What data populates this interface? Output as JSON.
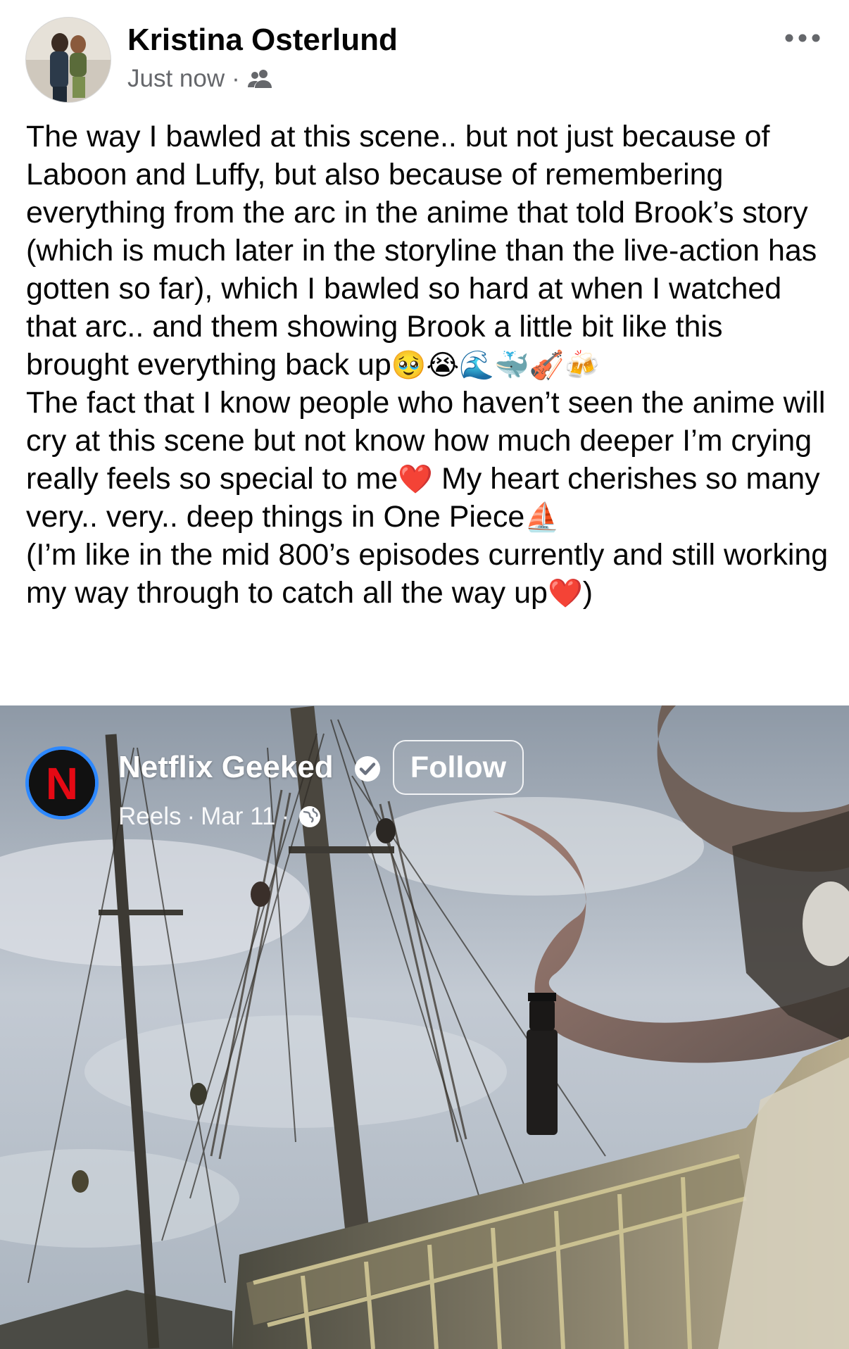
{
  "post": {
    "author": {
      "name": "Kristina Osterlund",
      "avatar_icon": "profile-photo"
    },
    "timestamp": "Just now",
    "separator": "·",
    "audience_icon": "friends-icon",
    "more_icon": "more-options-icon",
    "text": {
      "p1": "The way I bawled at this scene.. but not just because of Laboon and Luffy, but also because of remembering everything from the arc in the anime that told Brook’s story (which is much later in the storyline than the live-action has gotten so far), which I bawled so hard at when I watched that arc.. and them showing Brook a little bit like this brought everything back up",
      "p1_emoji": "🥹😭🌊🐳🎻🍻",
      "p2a": "The fact that I know people who haven’t seen the anime will cry at this scene but not know how much deeper I’m crying really feels so special to me",
      "p2_heart": "❤️",
      "p2b": " My heart cherishes so many very.. very.. deep things in One Piece",
      "p2_boat": "⛵",
      "p3a": "(I’m like in the mid 800’s episodes currently and still working my way through to catch all the way up",
      "p3_heart": "❤️",
      "p3b": ")"
    }
  },
  "shared_reel": {
    "page_name": "Netflix Geeked",
    "verified_icon": "verified-badge-icon",
    "follow_label": "Follow",
    "type": "Reels",
    "date": "Mar 11",
    "separator": "·",
    "privacy_icon": "globe-icon",
    "logo_letter": "N"
  },
  "colors": {
    "text": "#050505",
    "secondary_text": "#65676b",
    "netflix_red": "#e50914",
    "avatar_ring": "#2d88ff"
  }
}
